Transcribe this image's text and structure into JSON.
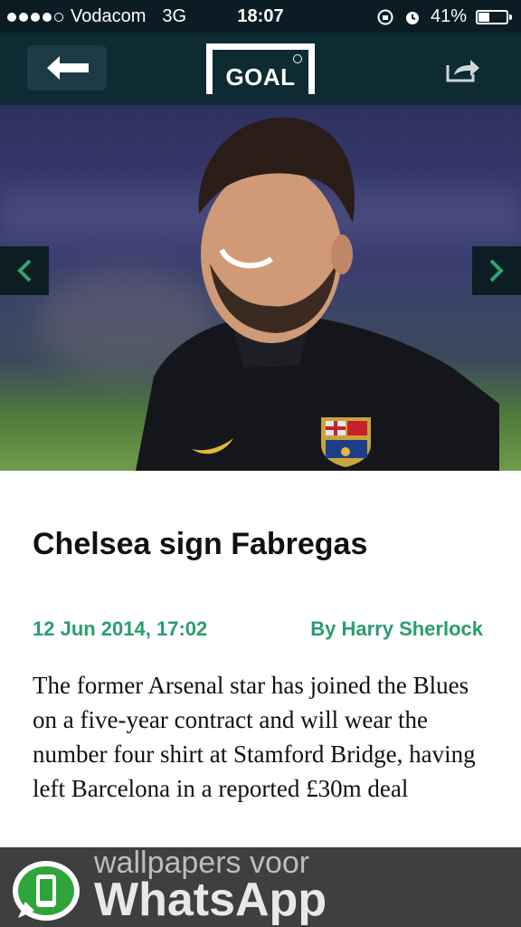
{
  "status_bar": {
    "carrier": "Vodacom",
    "network": "3G",
    "time": "18:07",
    "battery_text": "41%",
    "battery_level": 0.41,
    "signal_bars": 4
  },
  "nav": {
    "back_icon": "back-arrow-icon",
    "logo_text": "GOAL",
    "share_icon": "share-icon"
  },
  "hero": {
    "prev_icon": "chevron-left-icon",
    "next_icon": "chevron-right-icon"
  },
  "article": {
    "title": "Chelsea sign Fabregas",
    "date": "12 Jun 2014, 17:02",
    "author": "By Harry Sherlock",
    "body": "The former Arsenal star has joined the Blues on a five-year contract and will wear the number four shirt at Stamford Bridge, having left Barcelona in a reported £30m deal"
  },
  "watermark": {
    "line1": "wallpapers voor",
    "line2": "WhatsApp"
  },
  "colors": {
    "accent": "#2a9d6e",
    "nav_bg": "#0e2a33",
    "status_bg": "#0c1c25"
  }
}
